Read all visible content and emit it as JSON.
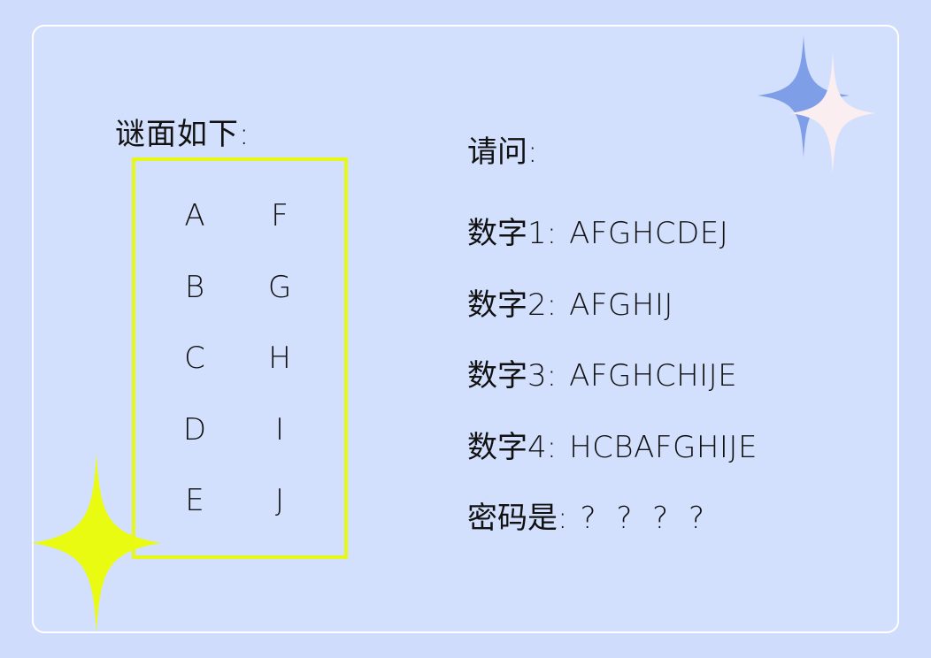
{
  "riddle": {
    "title": "谜面如下:",
    "left_column": [
      "A",
      "B",
      "C",
      "D",
      "E"
    ],
    "right_column": [
      "F",
      "G",
      "H",
      "I",
      "J"
    ]
  },
  "question": {
    "title": "请问:",
    "numbers": [
      {
        "label": "数字1:",
        "value": "AFGHCDEJ"
      },
      {
        "label": "数字2:",
        "value": "AFGHIJ"
      },
      {
        "label": "数字3:",
        "value": "AFGHCHIJE"
      },
      {
        "label": "数字4:",
        "value": "HCBAFGHIJE"
      }
    ],
    "password_label": "密码是:",
    "password_value": "? ? ? ?"
  },
  "colors": {
    "background": "#cfdcfb",
    "box_border": "#e6f816",
    "sparkle_yellow": "#e8fb10",
    "sparkle_blue": "#7f9ee8",
    "sparkle_pink": "#fbeef0"
  }
}
